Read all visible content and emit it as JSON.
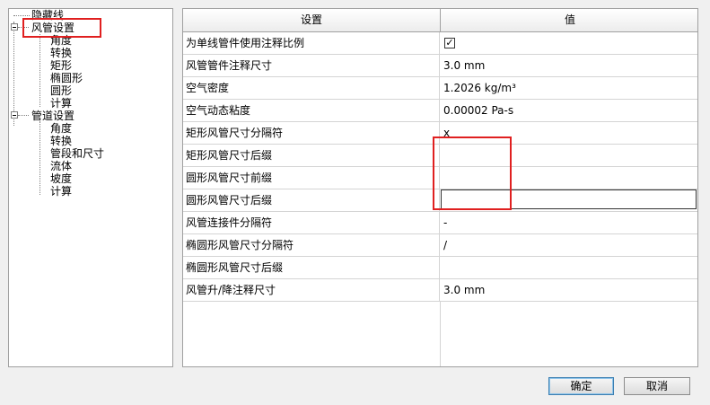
{
  "tree": {
    "items": [
      {
        "label": "隐藏线"
      },
      {
        "label": "风管设置"
      },
      {
        "label": "角度"
      },
      {
        "label": "转换"
      },
      {
        "label": "矩形"
      },
      {
        "label": "椭圆形"
      },
      {
        "label": "圆形"
      },
      {
        "label": "计算"
      },
      {
        "label": "管道设置"
      },
      {
        "label": "角度"
      },
      {
        "label": "转换"
      },
      {
        "label": "管段和尺寸"
      },
      {
        "label": "流体"
      },
      {
        "label": "坡度"
      },
      {
        "label": "计算"
      }
    ]
  },
  "grid": {
    "header": {
      "setting": "设置",
      "value": "值"
    },
    "rows": [
      {
        "name": "为单线管件使用注释比例",
        "value": "",
        "checked": true
      },
      {
        "name": "风管管件注释尺寸",
        "value": "3.0 mm"
      },
      {
        "name": "空气密度",
        "value": "1.2026 kg/m³"
      },
      {
        "name": "空气动态粘度",
        "value": "0.00002 Pa-s"
      },
      {
        "name": "矩形风管尺寸分隔符",
        "value": "x"
      },
      {
        "name": "矩形风管尺寸后缀",
        "value": ""
      },
      {
        "name": "圆形风管尺寸前缀",
        "value": ""
      },
      {
        "name": "圆形风管尺寸后缀",
        "value": ""
      },
      {
        "name": "风管连接件分隔符",
        "value": "-"
      },
      {
        "name": "椭圆形风管尺寸分隔符",
        "value": "/"
      },
      {
        "name": "椭圆形风管尺寸后缀",
        "value": ""
      },
      {
        "name": "风管升/降注释尺寸",
        "value": "3.0 mm"
      }
    ]
  },
  "buttons": {
    "ok": "确定",
    "cancel": "取消"
  },
  "colors": {
    "highlight": "#e02020",
    "default_button_border": "#3c7fb1"
  },
  "icons": {
    "checkbox": "check-mark-icon",
    "tree_expander": "collapse-minus-icon"
  }
}
